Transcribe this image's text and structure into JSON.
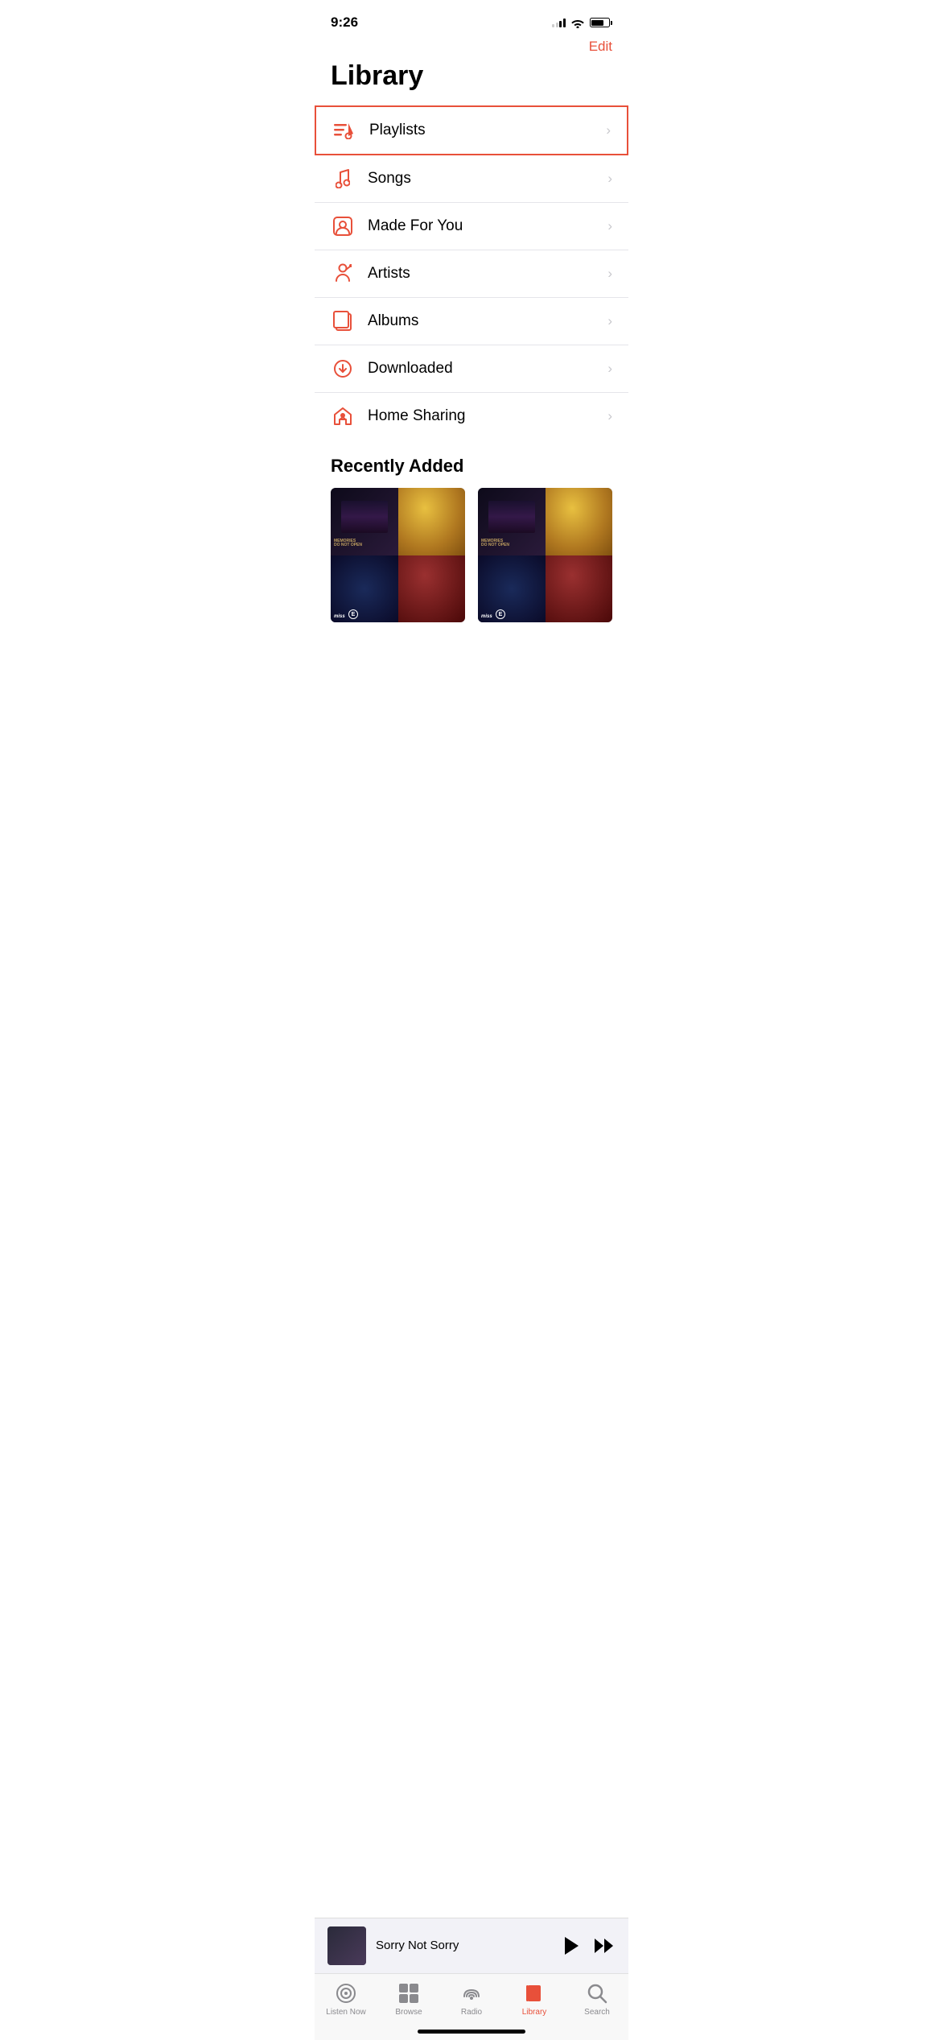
{
  "statusBar": {
    "time": "9:26",
    "battery": "75"
  },
  "header": {
    "editLabel": "Edit",
    "pageTitle": "Library"
  },
  "libraryItems": [
    {
      "id": "playlists",
      "label": "Playlists",
      "highlighted": true
    },
    {
      "id": "songs",
      "label": "Songs",
      "highlighted": false
    },
    {
      "id": "made-for-you",
      "label": "Made For You",
      "highlighted": false
    },
    {
      "id": "artists",
      "label": "Artists",
      "highlighted": false
    },
    {
      "id": "albums",
      "label": "Albums",
      "highlighted": false
    },
    {
      "id": "downloaded",
      "label": "Downloaded",
      "highlighted": false
    },
    {
      "id": "home-sharing",
      "label": "Home Sharing",
      "highlighted": false
    }
  ],
  "recentlyAdded": {
    "title": "Recently Added"
  },
  "miniPlayer": {
    "title": "Sorry Not Sorry"
  },
  "tabBar": {
    "items": [
      {
        "id": "listen-now",
        "label": "Listen Now",
        "active": false
      },
      {
        "id": "browse",
        "label": "Browse",
        "active": false
      },
      {
        "id": "radio",
        "label": "Radio",
        "active": false
      },
      {
        "id": "library",
        "label": "Library",
        "active": true
      },
      {
        "id": "search",
        "label": "Search",
        "active": false
      }
    ]
  }
}
